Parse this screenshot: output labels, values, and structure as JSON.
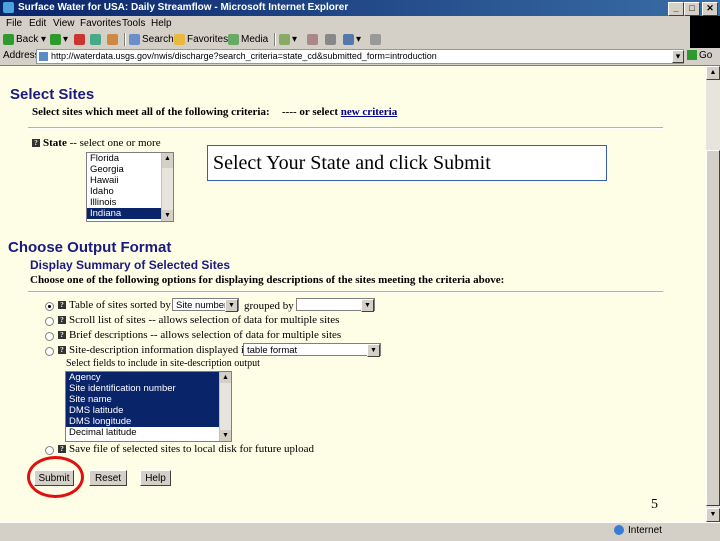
{
  "window": {
    "title": "Surface Water for USA: Daily Streamflow - Microsoft Internet Explorer",
    "controls": [
      "_",
      "□",
      "✕"
    ]
  },
  "menu": [
    "File",
    "Edit",
    "View",
    "Favorites",
    "Tools",
    "Help"
  ],
  "toolbar": {
    "back": "Back",
    "search": "Search",
    "favorites": "Favorites",
    "media": "Media"
  },
  "address": {
    "label": "Address",
    "url": "http://waterdata.usgs.gov/nwis/discharge?search_criteria=state_cd&submitted_form=introduction",
    "go": "Go"
  },
  "select_sites": {
    "heading": "Select Sites",
    "instruction": "Select sites which meet all of the following criteria:",
    "or_text": "---- or select",
    "new_criteria_link": "new criteria",
    "state_label": "State",
    "state_hint": "-- select one or more",
    "states": [
      {
        "label": "Florida",
        "selected": false
      },
      {
        "label": "Georgia",
        "selected": false
      },
      {
        "label": "Hawaii",
        "selected": false
      },
      {
        "label": "Idaho",
        "selected": false
      },
      {
        "label": "Illinois",
        "selected": false
      },
      {
        "label": "Indiana",
        "selected": true
      }
    ]
  },
  "callout": "Select Your State and click Submit",
  "output_format": {
    "heading": "Choose Output Format",
    "subheading": "Display Summary of Selected Sites",
    "instruction": "Choose one of the following options for displaying descriptions of the sites meeting the criteria above:",
    "option1_label": "Table of sites sorted by",
    "sort_by": "Site number",
    "grouped_by_label": "grouped by",
    "grouped_by": "",
    "option2_label": "Scroll list of sites -- allows selection of data for multiple sites",
    "option3_label": "Brief descriptions -- allows selection of data for multiple sites",
    "option4_label": "Site-description information displayed in",
    "display_format": "table format",
    "fields_label": "Select fields to include in site-description output",
    "fields": [
      {
        "label": "Agency",
        "selected": true
      },
      {
        "label": "Site identification number",
        "selected": true
      },
      {
        "label": "Site name",
        "selected": true
      },
      {
        "label": "DMS latitude",
        "selected": true
      },
      {
        "label": "DMS longitude",
        "selected": true
      },
      {
        "label": "Decimal latitude",
        "selected": false
      }
    ],
    "option5_label": "Save file of selected sites to local disk for future upload"
  },
  "buttons": {
    "submit": "Submit",
    "reset": "Reset",
    "help": "Help"
  },
  "slide_number": "5",
  "status": {
    "zone": "Internet"
  },
  "colors": {
    "heading": "#1a1a80",
    "page_bg": "#fefde6",
    "callout_border": "#3c5ea8",
    "highlight_ring": "#e01010",
    "selection": "#0a246a"
  }
}
